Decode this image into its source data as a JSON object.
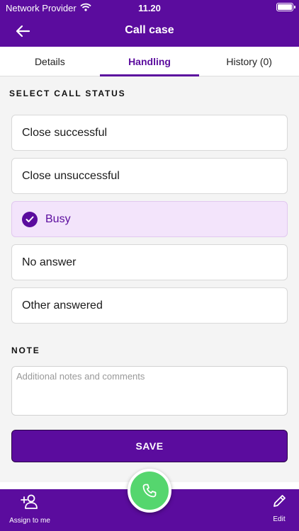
{
  "status_bar": {
    "provider": "Network Provider",
    "time": "11.20"
  },
  "header": {
    "title": "Call case"
  },
  "tabs": [
    {
      "label": "Details",
      "active": false
    },
    {
      "label": "Handling",
      "active": true
    },
    {
      "label": "History (0)",
      "active": false
    }
  ],
  "call_status": {
    "label": "SELECT CALL STATUS",
    "options": [
      {
        "label": "Close successful",
        "selected": false
      },
      {
        "label": "Close unsuccessful",
        "selected": false
      },
      {
        "label": "Busy",
        "selected": true
      },
      {
        "label": "No answer",
        "selected": false
      },
      {
        "label": "Other answered",
        "selected": false
      }
    ]
  },
  "note": {
    "label": "NOTE",
    "value": "",
    "placeholder": "Additional notes and comments"
  },
  "save_label": "SAVE",
  "bottom_bar": {
    "assign_label": "Assign to me",
    "edit_label": "Edit"
  },
  "colors": {
    "primary": "#5b0c9e",
    "selected_bg": "#f3e4fb",
    "call_button": "#55d66e"
  },
  "icons": [
    "wifi-icon",
    "battery-icon",
    "back-arrow-icon",
    "check-circle-icon",
    "add-user-icon",
    "phone-icon",
    "pencil-icon"
  ]
}
